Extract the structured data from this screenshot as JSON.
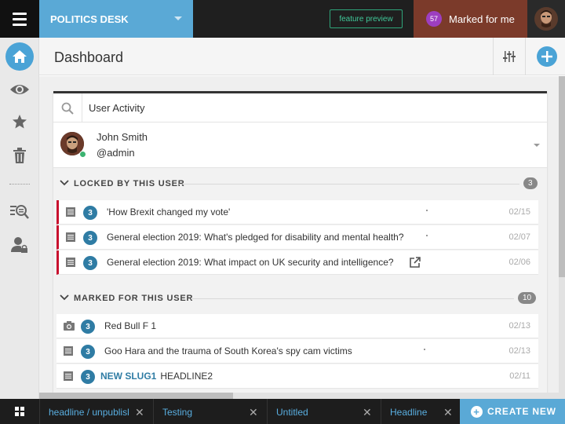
{
  "topbar": {
    "desk_name": "POLITICS DESK",
    "feature_preview": "feature preview",
    "marked_count": "57",
    "marked_label": "Marked for me"
  },
  "header": {
    "title": "Dashboard"
  },
  "widget": {
    "search_value": "User Activity",
    "user": {
      "name": "John Smith",
      "handle": "@admin",
      "status": "online"
    },
    "groups": [
      {
        "title": "LOCKED BY THIS USER",
        "count": "3",
        "items": [
          {
            "type": "text",
            "priority": "3",
            "title": "'How Brexit changed my vote'",
            "date": "02/15"
          },
          {
            "type": "text",
            "priority": "3",
            "title": "General election 2019: What's pledged for disability and mental health?",
            "date": "02/07"
          },
          {
            "type": "text",
            "priority": "3",
            "title": "General election 2019: What impact on UK security and intelligence?",
            "date": "02/06"
          }
        ]
      },
      {
        "title": "MARKED FOR THIS USER",
        "count": "10",
        "items": [
          {
            "type": "picture",
            "priority": "3",
            "title": "Red Bull F 1",
            "date": "02/13"
          },
          {
            "type": "text",
            "priority": "3",
            "title": "Goo Hara and the trauma of South Korea's spy cam victims",
            "date": "02/13"
          },
          {
            "type": "text",
            "priority": "3",
            "slug": "NEW SLUG1",
            "title": "HEADLINE2",
            "date": "02/11"
          }
        ]
      }
    ]
  },
  "taskbar": {
    "tabs": [
      {
        "label": "headline / unpublisl"
      },
      {
        "label": "Testing"
      },
      {
        "label": "Untitled"
      },
      {
        "label": "Headline"
      }
    ],
    "create_label": "CREATE NEW"
  },
  "colors": {
    "accent": "#5aa9d6",
    "locked": "#c8102e",
    "priority": "#2f7ca4",
    "marked_bg": "#7b3a2a",
    "marked_badge": "#9d3ec0",
    "feature_preview": "#40c99a"
  }
}
